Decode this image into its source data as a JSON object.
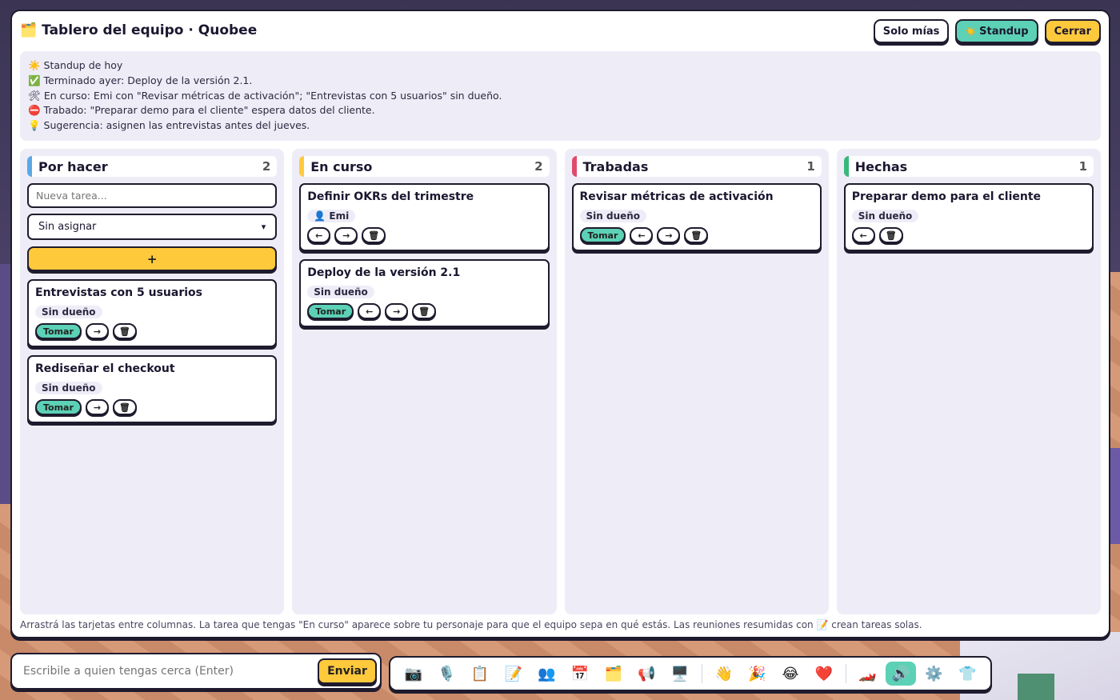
{
  "header": {
    "icon": "🗂️",
    "title": "Tablero del equipo · Quobee",
    "btn_mine": "Solo mías",
    "btn_standup_icon": "☀️",
    "btn_standup": "Standup",
    "btn_close": "Cerrar"
  },
  "summary": {
    "lines": [
      "☀️ Standup de hoy",
      "✅ Terminado ayer: Deploy de la versión 2.1.",
      "🛠 En curso: Emi con \"Revisar métricas de activación\"; \"Entrevistas con 5 usuarios\" sin dueño.",
      "⛔ Trabado: \"Preparar demo para el cliente\" espera datos del cliente.",
      "💡 Sugerencia: asignen las entrevistas antes del jueves."
    ]
  },
  "columns": [
    {
      "title": "Por hacer",
      "count": "2",
      "new_task_placeholder": "Nueva tarea...",
      "assign_value": "Sin asignar",
      "add_label": "+",
      "cards": [
        {
          "title": "Entrevistas con 5 usuarios",
          "owner": "Sin dueño",
          "take": "Tomar"
        },
        {
          "title": "Rediseñar el checkout",
          "owner": "Sin dueño",
          "take": "Tomar"
        }
      ]
    },
    {
      "title": "En curso",
      "count": "2",
      "cards": [
        {
          "title": "Definir OKRs del trimestre",
          "owner": "👤 Emi"
        },
        {
          "title": "Deploy de la versión 2.1",
          "owner": "Sin dueño",
          "take": "Tomar"
        }
      ]
    },
    {
      "title": "Trabadas",
      "count": "1",
      "cards": [
        {
          "title": "Revisar métricas de activación",
          "owner": "Sin dueño",
          "take": "Tomar"
        }
      ]
    },
    {
      "title": "Hechas",
      "count": "1",
      "cards": [
        {
          "title": "Preparar demo para el cliente",
          "owner": "Sin dueño"
        }
      ]
    }
  ],
  "actions": {
    "left": "←",
    "right": "→",
    "delete": "🗑"
  },
  "footnote": "Arrastrá las tarjetas entre columnas. La tarea que tengas \"En curso\" aparece sobre tu personaje para que el equipo sepa en qué estás. Las reuniones resumidas con 📝 crean tareas solas.",
  "chat": {
    "placeholder": "Escribile a quien tengas cerca (Enter)",
    "send": "Enviar"
  },
  "toolbar": [
    {
      "name": "camera-icon",
      "glyph": "📷"
    },
    {
      "name": "microphone-icon",
      "glyph": "🎙️"
    },
    {
      "name": "clipboard-icon",
      "glyph": "📋"
    },
    {
      "name": "memo-icon",
      "glyph": "📝"
    },
    {
      "name": "people-icon",
      "glyph": "👥"
    },
    {
      "name": "calendar-icon",
      "glyph": "📅"
    },
    {
      "name": "board-icon",
      "glyph": "🗂️"
    },
    {
      "name": "megaphone-icon",
      "glyph": "📢"
    },
    {
      "name": "screen-share-icon",
      "glyph": "🖥️"
    },
    {
      "name": "wave-icon",
      "glyph": "👋"
    },
    {
      "name": "party-icon",
      "glyph": "🎉"
    },
    {
      "name": "laugh-icon",
      "glyph": "😂"
    },
    {
      "name": "heart-icon",
      "glyph": "❤️"
    },
    {
      "name": "race-car-icon",
      "glyph": "🏎️"
    },
    {
      "name": "speaker-icon",
      "glyph": "🔊"
    },
    {
      "name": "gear-icon",
      "glyph": "⚙️"
    },
    {
      "name": "shirt-icon",
      "glyph": "👕"
    }
  ],
  "colors": {
    "accent_yellow": "#ffc93c",
    "accent_teal": "#5cd1b5",
    "col_todo": "#5aa8e6",
    "col_doing": "#ffc93c",
    "col_blocked": "#e04a6a",
    "col_done": "#39b87b"
  }
}
